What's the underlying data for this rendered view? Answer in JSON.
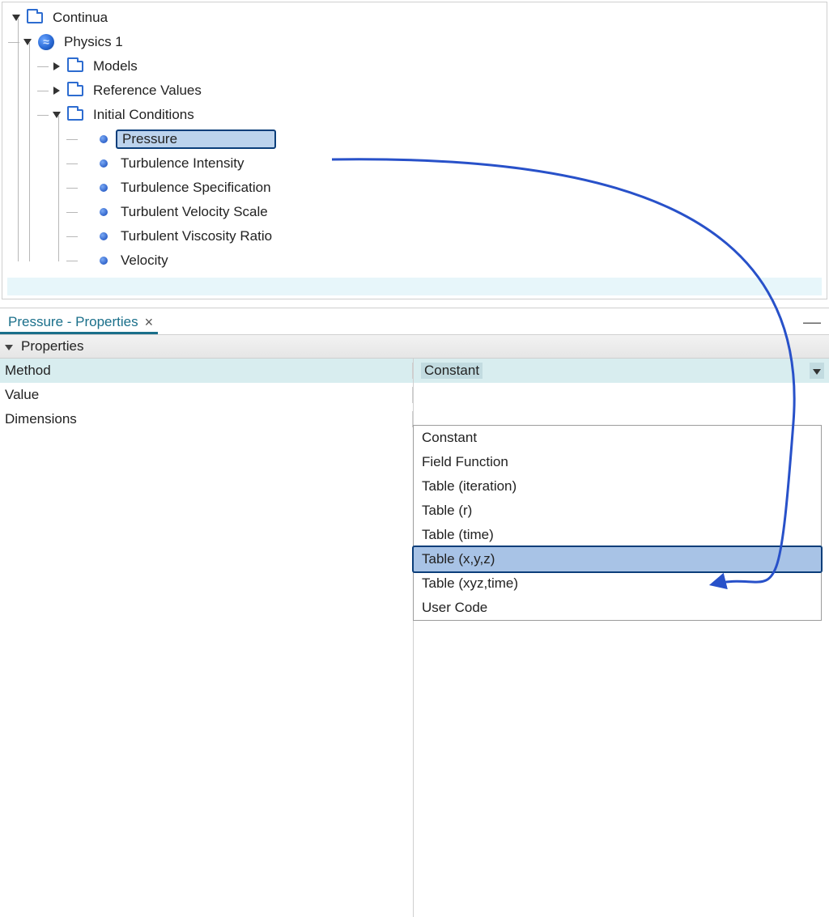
{
  "tree": {
    "continua": "Continua",
    "physics": "Physics 1",
    "models": "Models",
    "reference_values": "Reference Values",
    "initial_conditions": "Initial Conditions",
    "ic_items": [
      "Pressure",
      "Turbulence Intensity",
      "Turbulence Specification",
      "Turbulent Velocity Scale",
      "Turbulent Viscosity Ratio",
      "Velocity"
    ]
  },
  "properties": {
    "tab_title": "Pressure - Properties",
    "section": "Properties",
    "rows": {
      "method_label": "Method",
      "method_value": "Constant",
      "value_label": "Value",
      "dimensions_label": "Dimensions"
    }
  },
  "dropdown": {
    "items": [
      "Constant",
      "Field Function",
      "Table (iteration)",
      "Table (r)",
      "Table (time)",
      "Table (x,y,z)",
      "Table (xyz,time)",
      "User Code"
    ],
    "highlight_index": 5
  }
}
